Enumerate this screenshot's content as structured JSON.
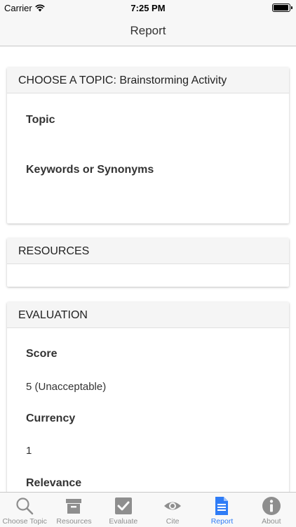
{
  "status_bar": {
    "carrier": "Carrier",
    "time": "7:25 PM",
    "battery_level": 1.0
  },
  "nav": {
    "title": "Report"
  },
  "topic_card": {
    "header": "CHOOSE A TOPIC: Brainstorming Activity",
    "topic_label": "Topic",
    "keywords_label": "Keywords or Synonyms"
  },
  "resources_card": {
    "header": "RESOURCES"
  },
  "evaluation_card": {
    "header": "EVALUATION",
    "score_label": "Score",
    "score_value": "5 (Unacceptable)",
    "currency_label": "Currency",
    "currency_value": "1",
    "relevance_label": "Relevance"
  },
  "tabs": [
    {
      "label": "Choose Topic",
      "icon": "search-icon"
    },
    {
      "label": "Resources",
      "icon": "archive-box-icon"
    },
    {
      "label": "Evaluate",
      "icon": "checkbox-icon"
    },
    {
      "label": "Cite",
      "icon": "eye-icon"
    },
    {
      "label": "Report",
      "icon": "document-icon",
      "active": true
    },
    {
      "label": "About",
      "icon": "info-icon"
    }
  ],
  "colors": {
    "active_tab": "#2f7cf6",
    "inactive_tab": "#8e8e8e"
  }
}
